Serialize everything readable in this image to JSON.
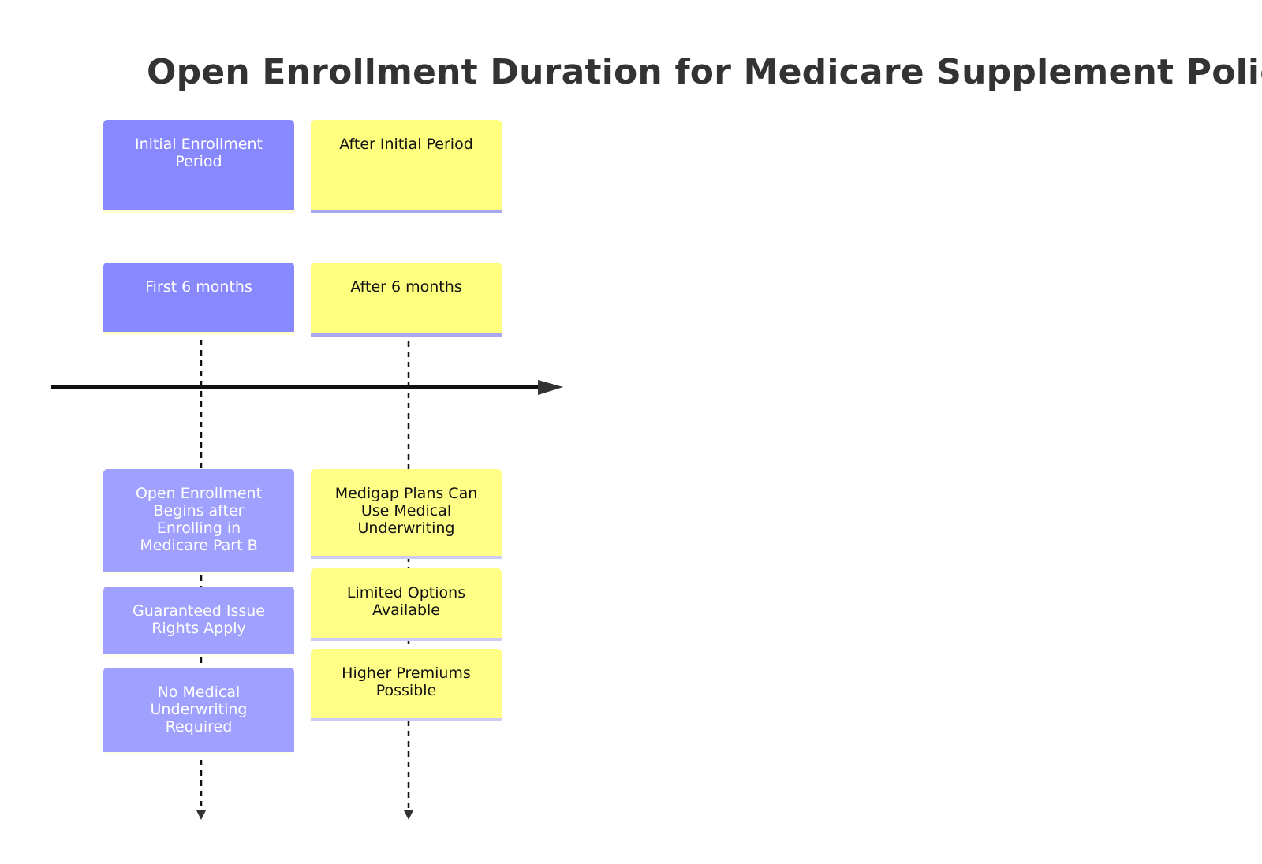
{
  "title": "Open Enrollment Duration for Medicare Supplement Policies",
  "colors": {
    "initial_header": "#8888ff",
    "initial_detail": "#a0a0ff",
    "after_header": "#ffff7f",
    "after_detail": "#ffff88",
    "axis": "#111111",
    "title_text": "#333333"
  },
  "columns": [
    {
      "period": "Initial Enrollment Period",
      "timeframe": "First 6 months",
      "events": [
        "Open Enrollment Begins after Enrolling in Medicare Part B",
        "Guaranteed Issue Rights Apply",
        "No Medical Underwriting Required"
      ]
    },
    {
      "period": "After Initial Period",
      "timeframe": "After 6 months",
      "events": [
        "Medigap Plans Can Use Medical Underwriting",
        "Limited Options Available",
        "Higher Premiums Possible"
      ]
    }
  ]
}
